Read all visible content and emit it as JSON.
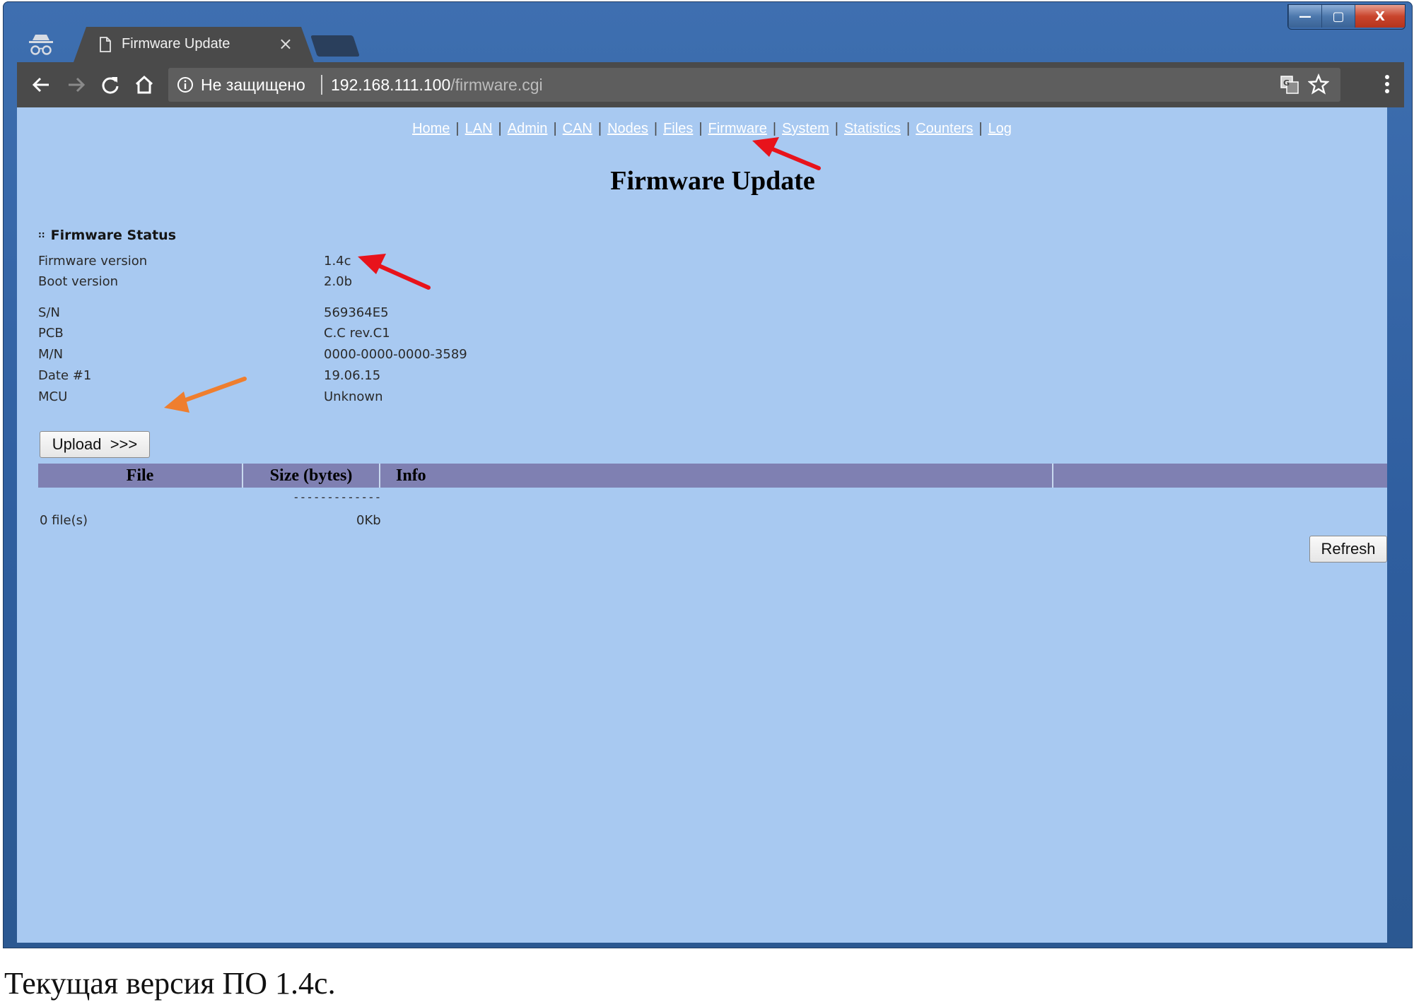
{
  "browser": {
    "tab_title": "Firmware Update",
    "tab_close": "×",
    "security_label": "Не защищено",
    "url_host": "192.168.111.100",
    "url_path": "/firmware.cgi",
    "window_controls": {
      "minimize": "—",
      "maximize": "▢",
      "close": "X"
    },
    "icons": [
      "incognito-icon",
      "document-icon",
      "back-arrow-icon",
      "forward-arrow-icon",
      "reload-icon",
      "home-icon",
      "info-icon",
      "translate-icon",
      "star-icon",
      "menu-dots-icon"
    ]
  },
  "nav": {
    "links": [
      "Home",
      "LAN",
      "Admin",
      "CAN",
      "Nodes",
      "Files",
      "Firmware",
      "System",
      "Statistics",
      "Counters",
      "Log"
    ],
    "separator": "|"
  },
  "page": {
    "title": "Firmware Update",
    "status_heading": "Firmware Status",
    "status_bullet": "::",
    "rows": [
      {
        "label": "Firmware version",
        "value": "1.4c"
      },
      {
        "label": "Boot version",
        "value": "2.0b"
      },
      {
        "label": "S/N",
        "value": "569364E5"
      },
      {
        "label": "PCB",
        "value": "C.C rev.C1"
      },
      {
        "label": "M/N",
        "value": "0000-0000-0000-3589"
      },
      {
        "label": "Date #1",
        "value": "19.06.15"
      },
      {
        "label": "MCU",
        "value": "Unknown"
      }
    ],
    "upload_button": "Upload  >>>",
    "table": {
      "headers": [
        "File",
        "Size (bytes)",
        "Info",
        ""
      ],
      "dashes": "-------------",
      "files_count": "0 file(s)",
      "total_size": "0Kb"
    },
    "refresh_button": "Refresh"
  },
  "caption": "Текущая версия ПО 1.4с.",
  "colors": {
    "page_background": "#a8c9f1",
    "table_header": "#7f80b2",
    "annotation_red": "#e8131b",
    "annotation_orange": "#ef7e2e"
  }
}
